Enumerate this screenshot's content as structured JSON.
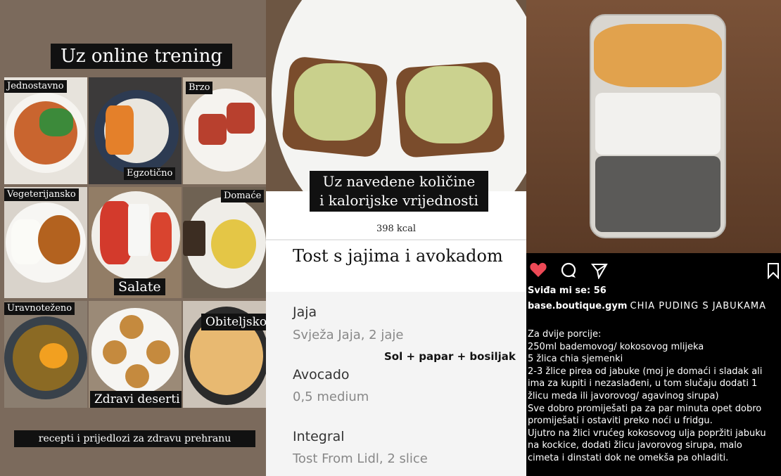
{
  "panel1": {
    "title": "Uz online trening",
    "tiles": [
      {
        "label": "Jednostavno"
      },
      {
        "label": "Egzotično"
      },
      {
        "label": "Brzo"
      },
      {
        "label": "Vegeterijansko"
      },
      {
        "label": "Salate"
      },
      {
        "label": "Domaće"
      },
      {
        "label": "Uravnoteženo"
      },
      {
        "label": "Zdravi deserti"
      },
      {
        "label": "Obiteljsko"
      }
    ],
    "footer": "recepti i prijedlozi za zdravu prehranu"
  },
  "panel2": {
    "headline_line1": "Uz navedene količine",
    "headline_line2": "i kalorijske vrijednosti",
    "kcal": "398 kcal",
    "recipe_title": "Tost s jajima i avokadom",
    "ingredients": [
      {
        "name": "Jaja",
        "desc": "Svježa Jaja, 2 jaje"
      },
      {
        "name": "Avocado",
        "desc": "0,5 medium"
      },
      {
        "name": "Integral",
        "desc": "Tost From Lidl, 2 slice"
      }
    ],
    "spice_note": "Sol + papar + bosiljak"
  },
  "panel3": {
    "icons": [
      "heart-icon",
      "comment-icon",
      "share-icon",
      "bookmark-icon"
    ],
    "likes": "Sviđa mi se: 56",
    "username": "base.boutique.gym",
    "caption_title": "CHIA PUDING S JABUKAMA",
    "lines": [
      "Za dvije porcije:",
      "250ml bademovog/ kokosovog mlijeka",
      "5 žlica chia sjemenki",
      "2-3 žlice pirea od jabuke (moj je domaći i sladak ali",
      "ima za kupiti i nezaslađeni, u tom slučaju dodati 1",
      "žlicu meda ili javorovog/ agavinog sirupa)",
      "Sve dobro promiješati pa za par minuta opet dobro",
      "promiješati i ostaviti preko noći u fridgu.",
      "Ujutro na žlici vrućeg kokosovog ulja popržiti jabuku",
      "na kockice, dodati žlicu javorovog sirupa, malo",
      "cimeta i dinstati dok ne omekša pa ohladiti."
    ],
    "colors": {
      "heart": "#ed4956"
    }
  }
}
